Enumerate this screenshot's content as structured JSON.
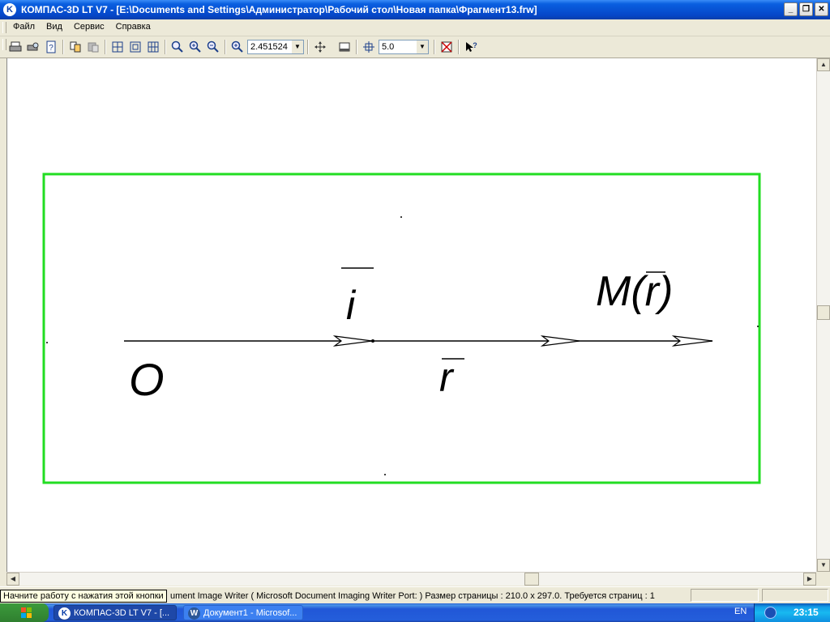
{
  "window": {
    "app_icon": "kompas-logo-icon",
    "title": "КОМПАС-3D LT V7 - [E:\\Documents and Settings\\Администратор\\Рабочий стол\\Новая папка\\Фрагмент13.frw]"
  },
  "menu": {
    "items": [
      {
        "label": "Файл"
      },
      {
        "label": "Вид"
      },
      {
        "label": "Сервис"
      },
      {
        "label": "Справка"
      }
    ]
  },
  "toolbar": {
    "zoom_value": "2.451524",
    "step_value": "5.0",
    "icons": [
      "print-icon",
      "print-preview-icon",
      "help-doc-icon",
      "copy-icon",
      "paste-icon",
      "select-all-icon",
      "select-window-icon",
      "grid-icon",
      "zoom-icon",
      "zoom-in-icon",
      "zoom-out-icon",
      "zoom-scale-icon",
      "pan-icon",
      "page-fit-icon",
      "step-cursor-icon",
      "view-icon",
      "context-help-icon"
    ]
  },
  "drawing": {
    "labels": {
      "origin": "O",
      "unit_vector": "i",
      "radius_vector": "r",
      "point": "M(r)"
    },
    "frame_color": "#22dd22"
  },
  "status": {
    "text": "Начните работу с нажатия этой кнопки",
    "printer_text": "ument Image Writer ( Microsoft Document Imaging Writer Port: )  Размер страницы : 210.0 x 297.0.  Требуется страниц : 1"
  },
  "taskbar": {
    "tasks": [
      {
        "label": "КОМПАС-3D LT V7 - [..."
      },
      {
        "label": "Документ1 - Microsof..."
      }
    ],
    "language": "EN",
    "clock": "23:15"
  }
}
